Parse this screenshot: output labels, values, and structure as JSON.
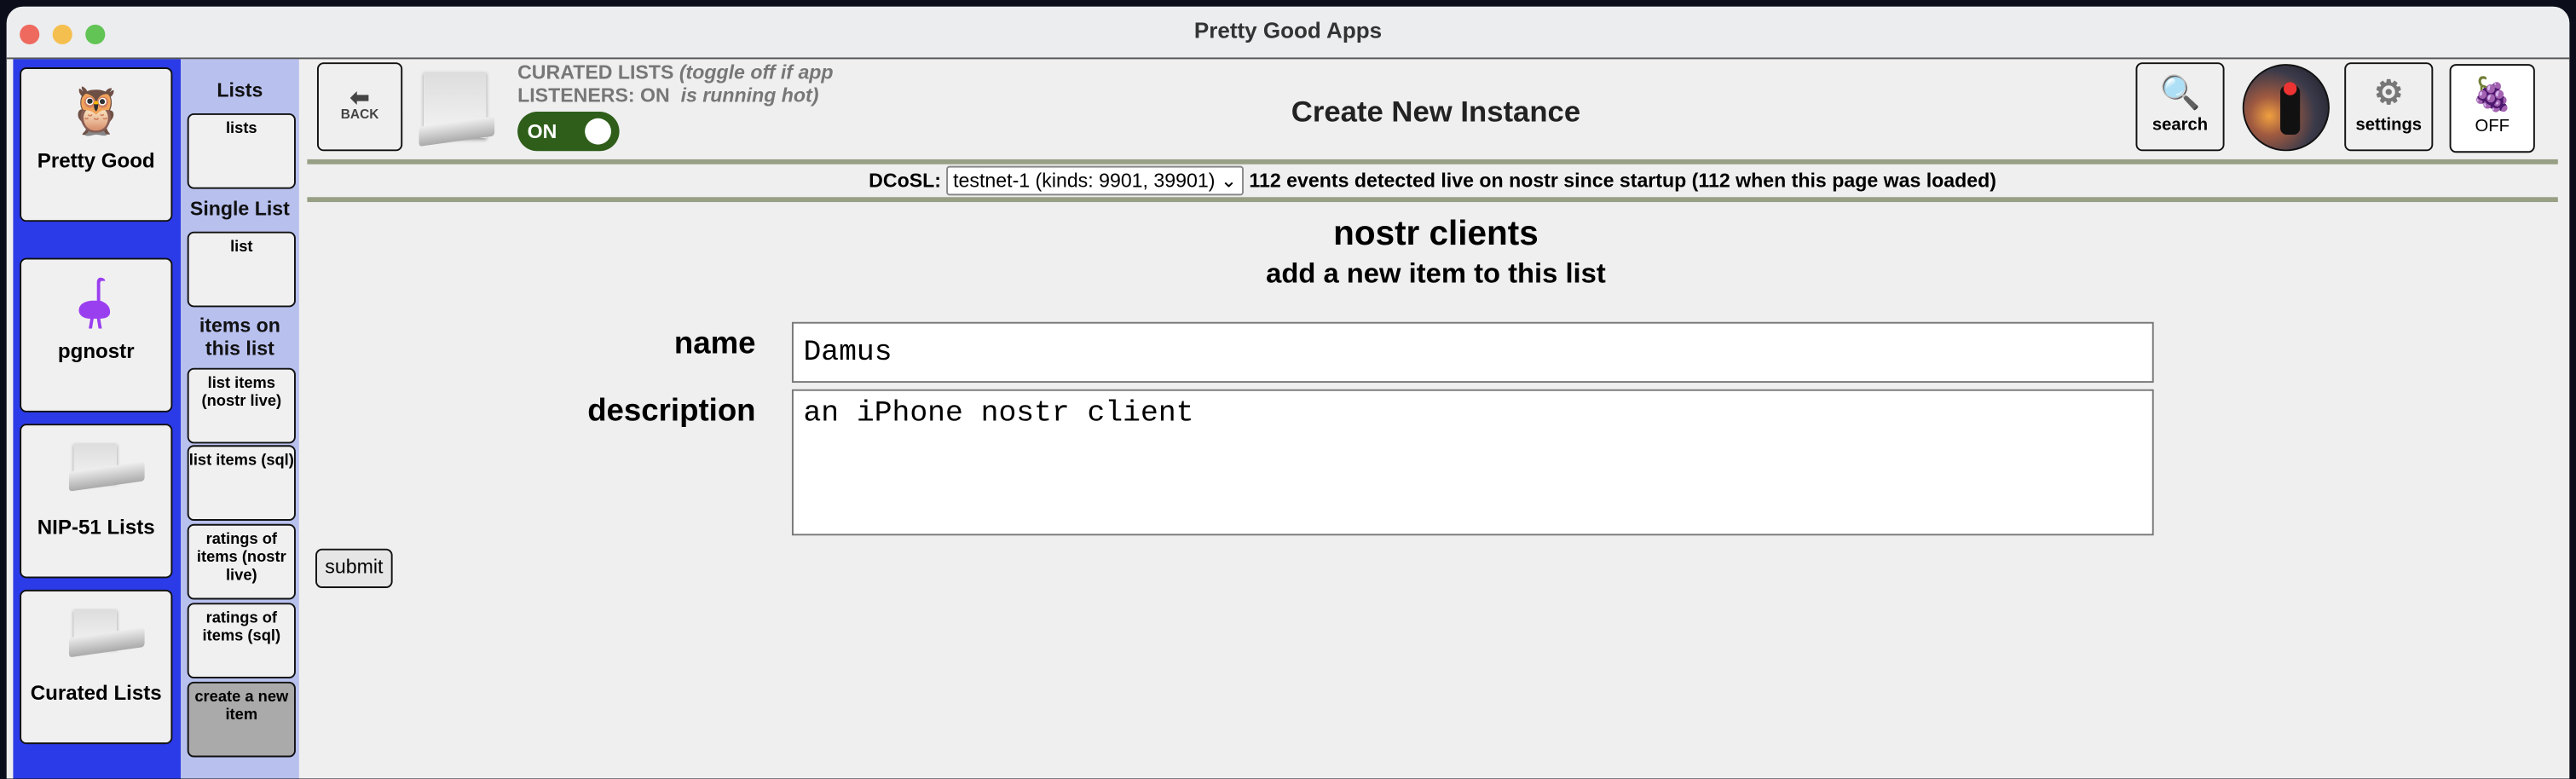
{
  "window": {
    "title": "Pretty Good Apps"
  },
  "apps": [
    {
      "label": "Pretty Good",
      "icon": "owl-icon"
    },
    {
      "label": "pgnostr",
      "icon": "ostrich-icon"
    },
    {
      "label": "NIP-51 Lists",
      "icon": "document-icon"
    },
    {
      "label": "Curated Lists",
      "icon": "document-icon"
    }
  ],
  "subnav": {
    "lists_header": "Lists",
    "lists_button": "lists",
    "single_header": "Single List",
    "single_button": "list",
    "items_header": "items on this list",
    "items": [
      {
        "label": "list items (nostr live)"
      },
      {
        "label": "list items (sql)"
      },
      {
        "label": "ratings of items (nostr live)"
      },
      {
        "label": "ratings of items (sql)"
      },
      {
        "label": "create a new item",
        "active": true
      }
    ]
  },
  "header": {
    "back_label": "BACK",
    "curated_lists_label": "CURATED LISTS",
    "listeners_label": "LISTENERS: ON",
    "hint_line1": "(toggle off if app",
    "hint_line2": "is running hot)",
    "toggle_label": "ON",
    "toggle_on": true,
    "page_title": "Create New Instance",
    "search_label": "search",
    "settings_label": "settings",
    "power_label": "OFF"
  },
  "dcosl": {
    "label": "DCoSL:",
    "selected": "testnet-1 (kinds: 9901, 39901)",
    "status": "112 events detected live on nostr since startup (112 when this page was loaded)"
  },
  "form": {
    "title": "nostr clients",
    "subtitle": "add a new item to this list",
    "name_label": "name",
    "name_value": "Damus",
    "description_label": "description",
    "description_value": "an iPhone nostr client",
    "submit_label": "submit"
  },
  "colors": {
    "sidebar": "#2b3be8",
    "subnav": "#b8c0ee",
    "toggle": "#2e5e1a",
    "divider": "#979f84",
    "active_item": "#aaaaaa"
  }
}
